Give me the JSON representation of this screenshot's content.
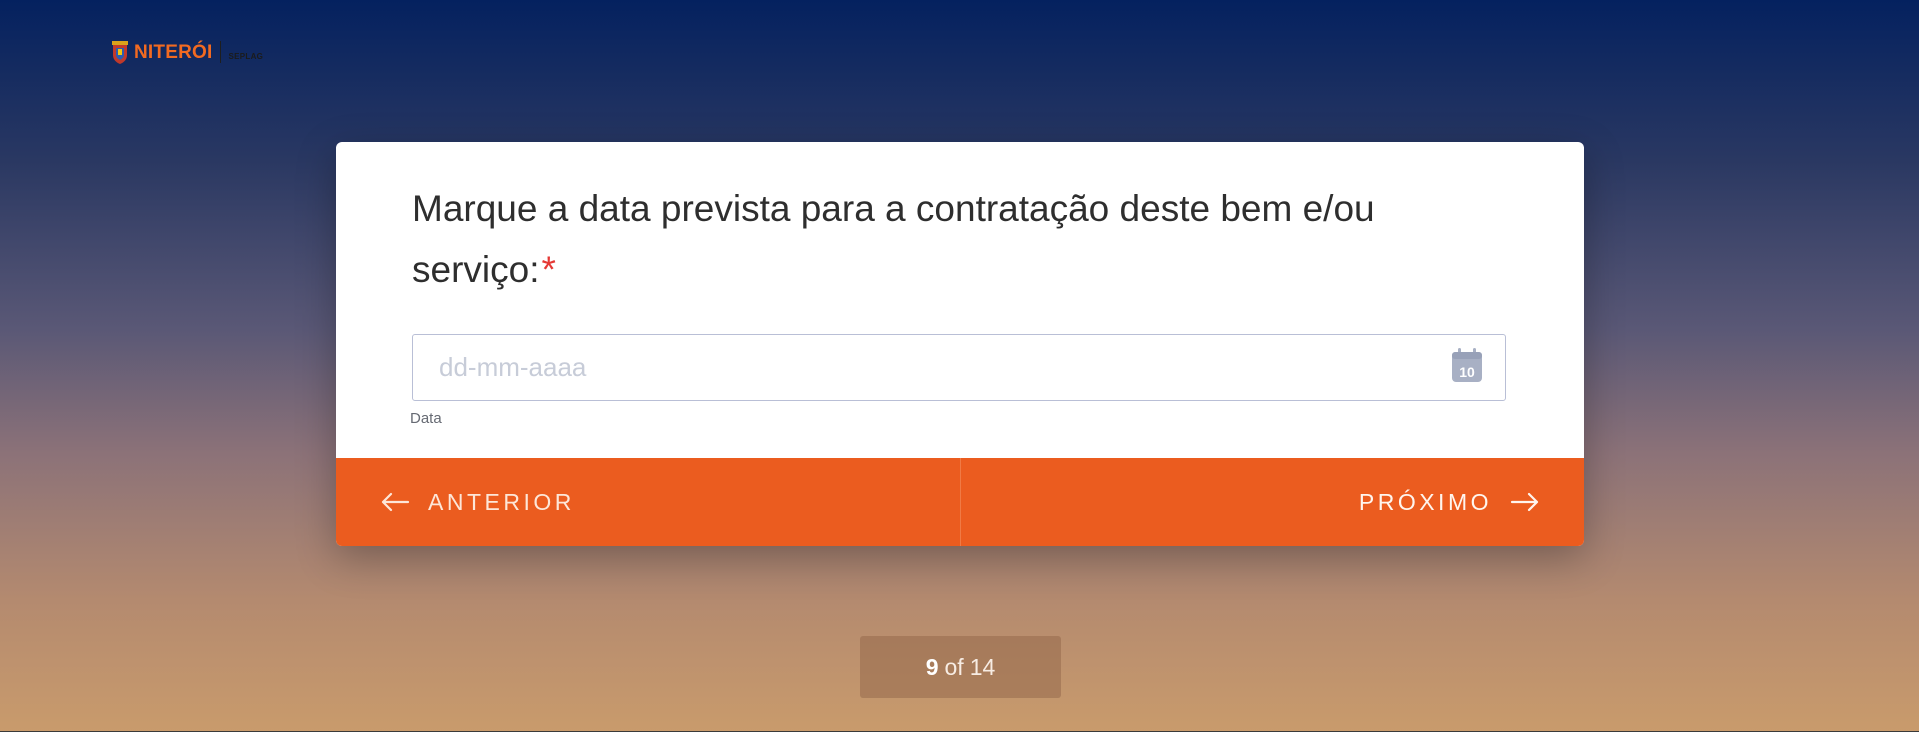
{
  "header": {
    "brand": "NITERÓI",
    "sub_brand": "SEPLAG"
  },
  "form": {
    "question": "Marque a data prevista para a contratação deste bem e/ou serviço:",
    "required_mark": "*",
    "date_input": {
      "placeholder": "dd-mm-aaaa",
      "value": ""
    },
    "calendar_icon_day": "10",
    "field_caption": "Data"
  },
  "navigation": {
    "prev_label": "ANTERIOR",
    "next_label": "PRÓXIMO"
  },
  "progress": {
    "current": "9",
    "separator": "of",
    "total": "14"
  },
  "colors": {
    "accent": "#eb5c1f",
    "brand_orange": "#f26a21",
    "required": "#e53935",
    "background_top": "#04215f",
    "background_bottom": "#c99b6c"
  },
  "icons": {
    "calendar": "calendar-icon",
    "prev_arrow": "arrow-left-icon",
    "next_arrow": "arrow-right-icon",
    "crest": "niteroi-crest-icon"
  }
}
